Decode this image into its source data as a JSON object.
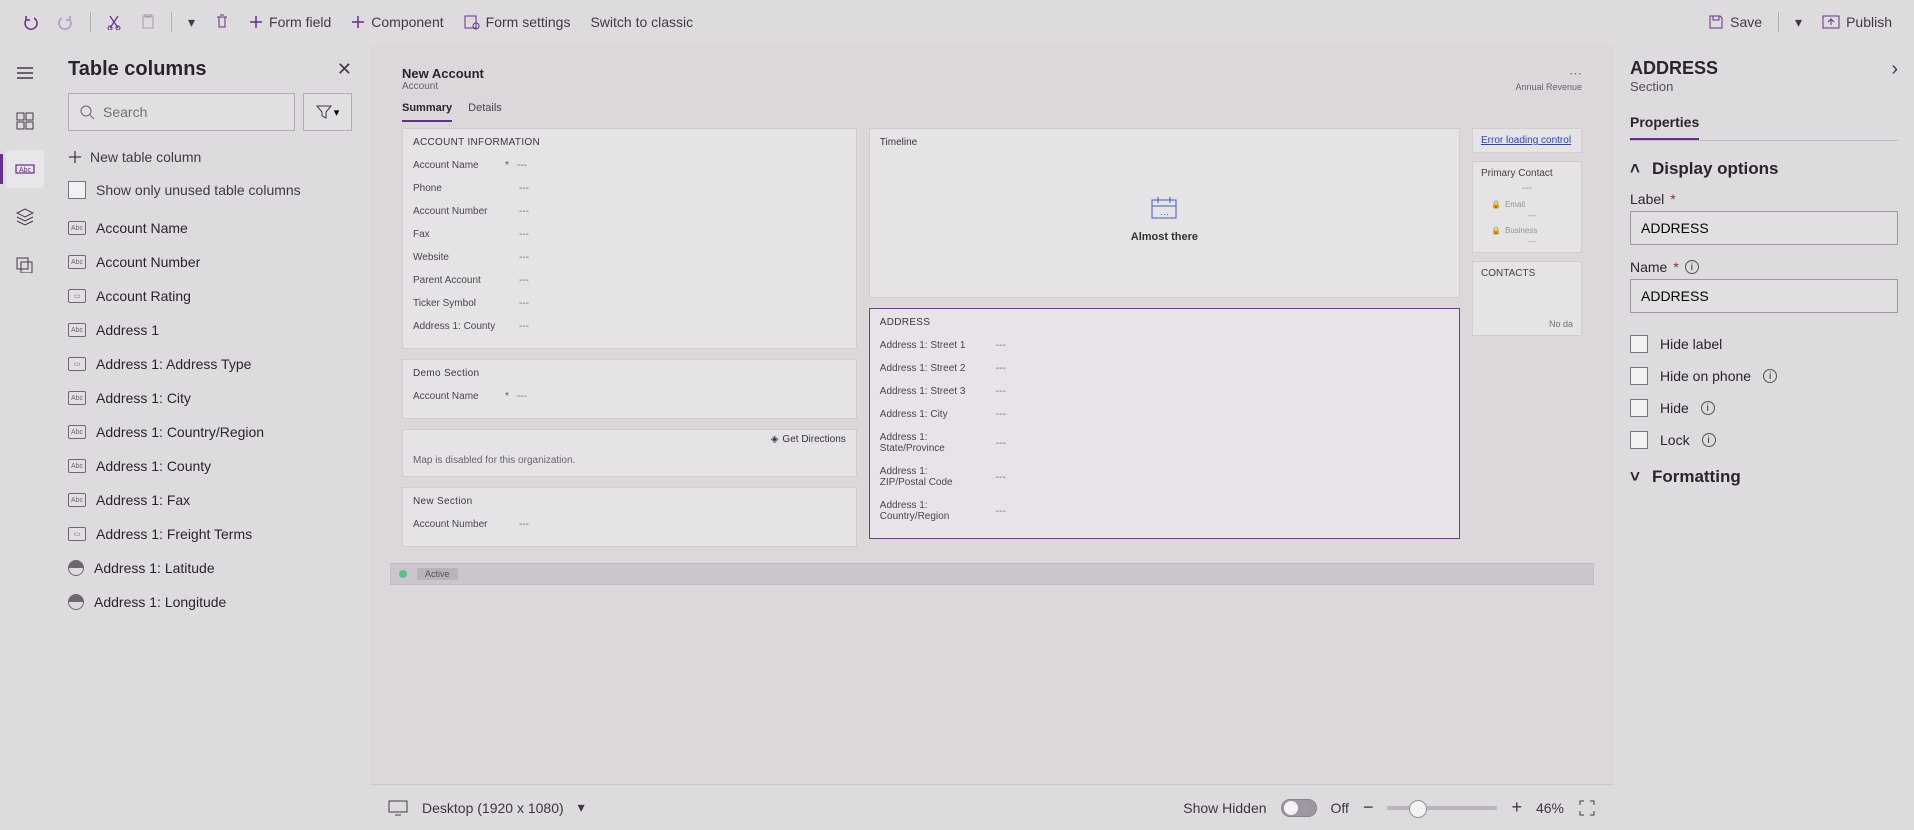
{
  "topbar": {
    "form_field": "Form field",
    "component": "Component",
    "form_settings": "Form settings",
    "switch_classic": "Switch to classic",
    "save": "Save",
    "publish": "Publish"
  },
  "leftrail": {},
  "columns_panel": {
    "title": "Table columns",
    "search_placeholder": "Search",
    "new_column": "New table column",
    "show_unused": "Show only unused table columns",
    "items": [
      {
        "label": "Account Name",
        "t": "Abc"
      },
      {
        "label": "Account Number",
        "t": "Abc"
      },
      {
        "label": "Account Rating",
        "t": "Opt"
      },
      {
        "label": "Address 1",
        "t": "Abc"
      },
      {
        "label": "Address 1: Address Type",
        "t": "Opt"
      },
      {
        "label": "Address 1: City",
        "t": "Abc"
      },
      {
        "label": "Address 1: Country/Region",
        "t": "Abc"
      },
      {
        "label": "Address 1: County",
        "t": "Abc"
      },
      {
        "label": "Address 1: Fax",
        "t": "Abc"
      },
      {
        "label": "Address 1: Freight Terms",
        "t": "Opt"
      },
      {
        "label": "Address 1: Latitude",
        "t": "Num"
      },
      {
        "label": "Address 1: Longitude",
        "t": "Num"
      }
    ]
  },
  "form": {
    "title": "New Account",
    "entity": "Account",
    "annual_revenue": "Annual Revenue",
    "tabs": [
      "Summary",
      "Details"
    ],
    "account_info": {
      "heading": "ACCOUNT INFORMATION",
      "fields": [
        {
          "label": "Account Name",
          "req": "*",
          "val": "---"
        },
        {
          "label": "Phone",
          "req": "",
          "val": "---"
        },
        {
          "label": "Account Number",
          "req": "",
          "val": "---"
        },
        {
          "label": "Fax",
          "req": "",
          "val": "---"
        },
        {
          "label": "Website",
          "req": "",
          "val": "---"
        },
        {
          "label": "Parent Account",
          "req": "",
          "val": "---"
        },
        {
          "label": "Ticker Symbol",
          "req": "",
          "val": "---"
        },
        {
          "label": "Address 1: County",
          "req": "",
          "val": "---"
        }
      ]
    },
    "demo": {
      "heading": "Demo Section",
      "fields": [
        {
          "label": "Account Name",
          "req": "*",
          "val": "---"
        }
      ]
    },
    "map": {
      "get_directions": "Get Directions",
      "disabled": "Map is disabled for this organization."
    },
    "new_section": {
      "heading": "New Section",
      "fields": [
        {
          "label": "Account Number",
          "req": "",
          "val": "---"
        }
      ]
    },
    "timeline": {
      "heading": "Timeline",
      "msg": "Almost there"
    },
    "address": {
      "heading": "ADDRESS",
      "fields": [
        {
          "label": "Address 1: Street 1",
          "val": "---"
        },
        {
          "label": "Address 1: Street 2",
          "val": "---"
        },
        {
          "label": "Address 1: Street 3",
          "val": "---"
        },
        {
          "label": "Address 1: City",
          "val": "---"
        },
        {
          "label": "Address 1: State/Province",
          "val": "---"
        },
        {
          "label": "Address 1: ZIP/Postal Code",
          "val": "---"
        },
        {
          "label": "Address 1: Country/Region",
          "val": "---"
        }
      ]
    },
    "error_link": "Error loading control",
    "side": {
      "primary_contact": "Primary Contact",
      "email": "Email",
      "business": "Business",
      "contacts": "CONTACTS",
      "nodata": "No da"
    },
    "status": {
      "active": "Active"
    }
  },
  "footer": {
    "viewport": "Desktop (1920 x 1080)",
    "show_hidden": "Show Hidden",
    "off": "Off",
    "zoom": "46%"
  },
  "rpanel": {
    "title": "ADDRESS",
    "subtitle": "Section",
    "tab": "Properties",
    "display_options": "Display options",
    "label_lbl": "Label",
    "label_val": "ADDRESS",
    "name_lbl": "Name",
    "name_val": "ADDRESS",
    "hide_label": "Hide label",
    "hide_phone": "Hide on phone",
    "hide": "Hide",
    "lock": "Lock",
    "formatting": "Formatting"
  }
}
